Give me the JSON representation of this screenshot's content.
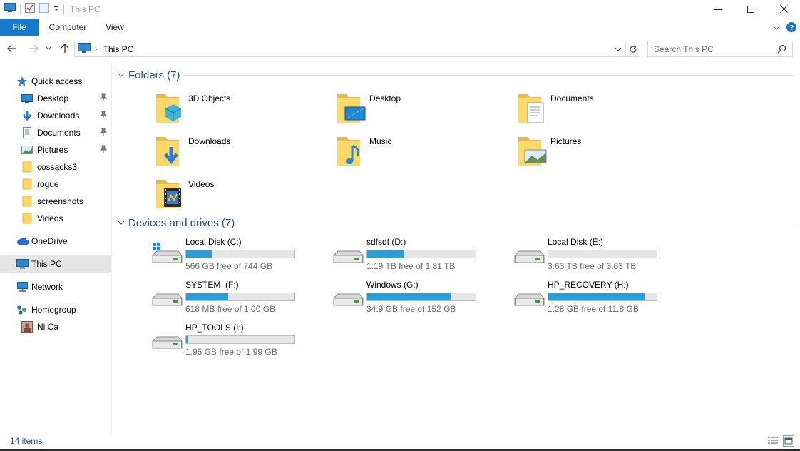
{
  "window": {
    "title": "This PC",
    "minimize_icon": "minimize-icon",
    "maximize_icon": "maximize-icon",
    "close_icon": "close-icon"
  },
  "ribbon": {
    "tabs": [
      {
        "label": "File",
        "active": true
      },
      {
        "label": "Computer"
      },
      {
        "label": "View"
      }
    ],
    "accent": "#1979ca"
  },
  "address": {
    "location": "This PC",
    "search_placeholder": "Search This PC"
  },
  "sidebar": {
    "quick_access": "Quick access",
    "pinned": [
      {
        "label": "Desktop",
        "icon": "desktop-icon"
      },
      {
        "label": "Downloads",
        "icon": "downloads-icon"
      },
      {
        "label": "Documents",
        "icon": "documents-icon"
      },
      {
        "label": "Pictures",
        "icon": "pictures-icon"
      }
    ],
    "folders": [
      "cossacks3",
      "rogue",
      "screenshots",
      "Videos"
    ],
    "onedrive": "OneDrive",
    "this_pc": "This PC",
    "network": "Network",
    "homegroup": "Homegroup",
    "user": "Ni Ca"
  },
  "folders": {
    "header": "Folders (7)",
    "items": [
      {
        "name": "3D Objects",
        "icon": "3d-objects-folder-icon"
      },
      {
        "name": "Desktop",
        "icon": "desktop-folder-icon"
      },
      {
        "name": "Documents",
        "icon": "documents-folder-icon"
      },
      {
        "name": "Downloads",
        "icon": "downloads-folder-icon"
      },
      {
        "name": "Music",
        "icon": "music-folder-icon"
      },
      {
        "name": "Pictures",
        "icon": "pictures-folder-icon"
      },
      {
        "name": "Videos",
        "icon": "videos-folder-icon"
      }
    ]
  },
  "drives": {
    "header": "Devices and drives (7)",
    "items": [
      {
        "name": "Local Disk (C:)",
        "free": "566 GB free of 744 GB",
        "used_fraction": 0.24,
        "system": true
      },
      {
        "name": "sdfsdf (D:)",
        "free": "1.19 TB free of 1.81 TB",
        "used_fraction": 0.34
      },
      {
        "name": "Local Disk (E:)",
        "free": "3.63 TB free of 3.63 TB",
        "used_fraction": 0.0
      },
      {
        "name": "SYSTEM  (F:)",
        "free": "618 MB free of 1.00 GB",
        "used_fraction": 0.39
      },
      {
        "name": "Windows (G:)",
        "free": "34.9 GB free of 152 GB",
        "used_fraction": 0.77
      },
      {
        "name": "HP_RECOVERY (H:)",
        "free": "1.28 GB free of 11.8 GB",
        "used_fraction": 0.89
      },
      {
        "name": "HP_TOOLS (I:)",
        "free": "1.95 GB free of 1.99 GB",
        "used_fraction": 0.02
      }
    ],
    "bar_color": "#26a0da"
  },
  "status": {
    "count": "14 items"
  }
}
